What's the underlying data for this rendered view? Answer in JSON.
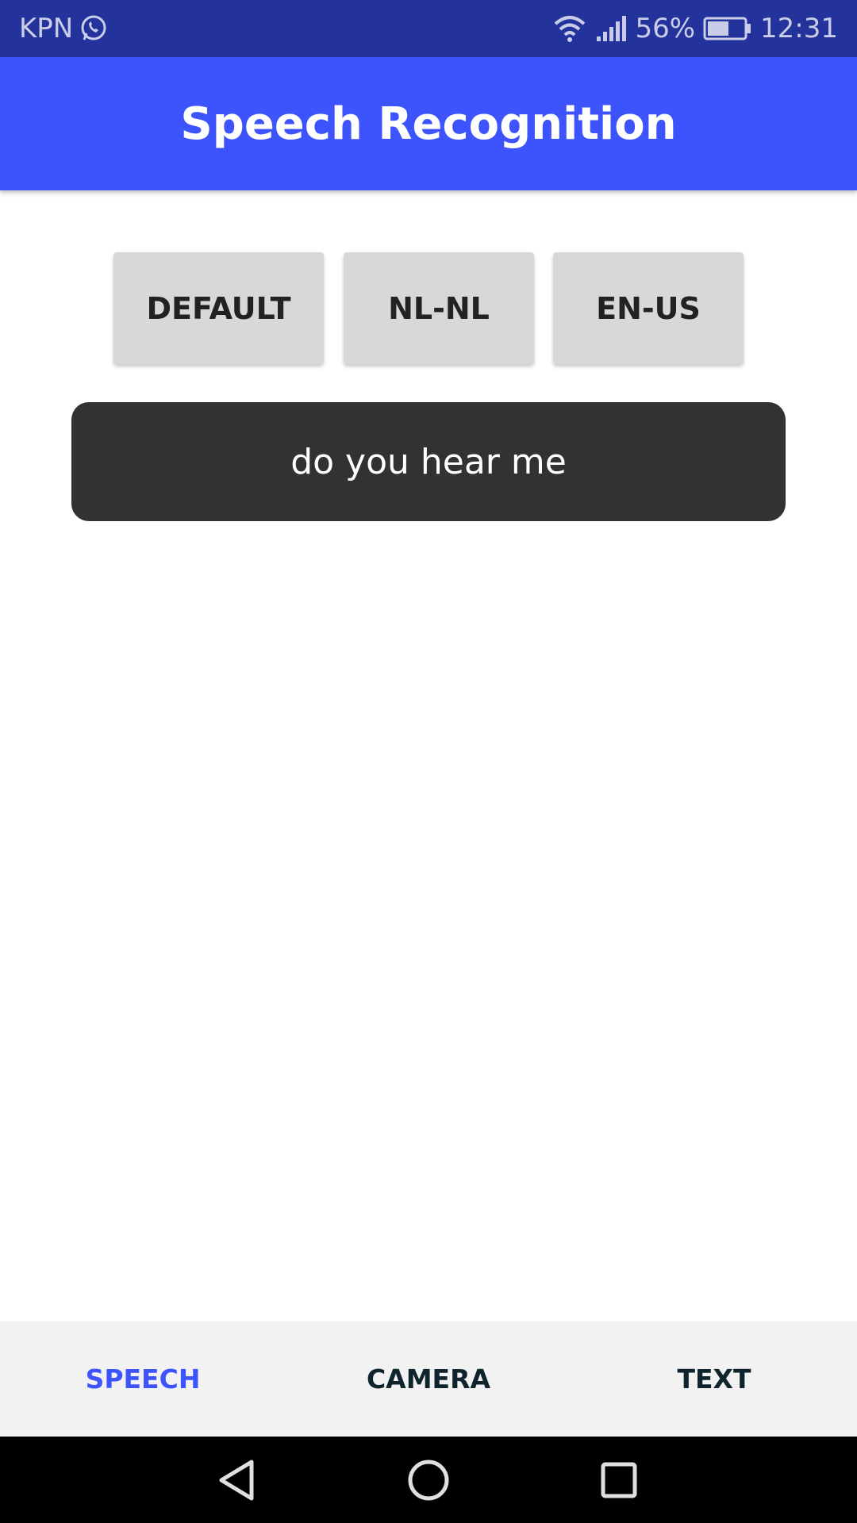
{
  "status_bar": {
    "carrier": "KPN",
    "battery": "56%",
    "time": "12:31",
    "icons": [
      "whatsapp-icon",
      "wifi-icon",
      "signal-icon",
      "battery-icon"
    ]
  },
  "app_bar": {
    "title": "Speech Recognition",
    "color": "#3d54fd"
  },
  "language_buttons": [
    {
      "label": "DEFAULT"
    },
    {
      "label": "NL-NL"
    },
    {
      "label": "EN-US"
    }
  ],
  "result": {
    "text": "do you hear me"
  },
  "tabs": [
    {
      "label": "SPEECH",
      "active": true,
      "color": "#3d54fd"
    },
    {
      "label": "CAMERA",
      "active": false
    },
    {
      "label": "TEXT",
      "active": false
    }
  ],
  "nav_bar": {
    "icons": [
      "back-icon",
      "home-icon",
      "recents-icon"
    ]
  }
}
